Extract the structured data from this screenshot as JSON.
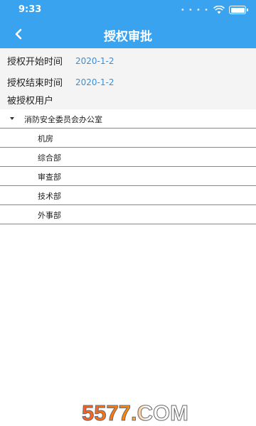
{
  "status_bar": {
    "time": "9:33"
  },
  "header": {
    "title": "授权审批",
    "back_icon": "chevron-left-icon"
  },
  "form": {
    "start_label": "授权开始时间",
    "start_value": "2020-1-2",
    "end_label": "授权结束时间",
    "end_value": "2020-1-2",
    "users_label": "被授权用户"
  },
  "tree": {
    "root_label": "消防安全委员会办公室",
    "items": [
      "机房",
      "综合部",
      "审查部",
      "技术部",
      "外事部"
    ]
  },
  "watermark": {
    "text": "5577.COM"
  },
  "colors": {
    "accent": "#3aa3f0",
    "value_text": "#3a8fd9",
    "form_bg": "#f4f4f4"
  }
}
